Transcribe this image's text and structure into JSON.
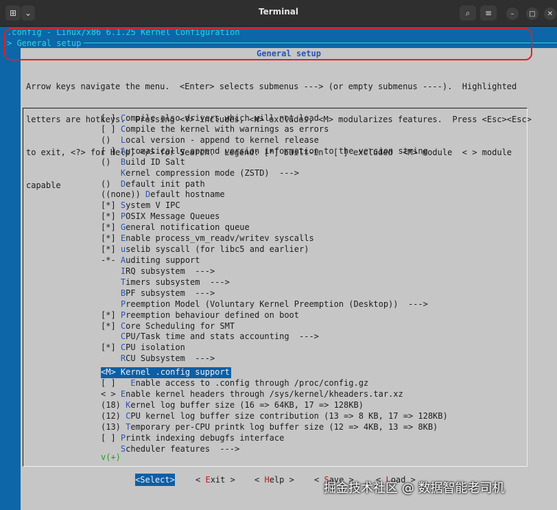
{
  "window": {
    "title": "Terminal",
    "left_buttons": [
      "new-tab",
      "dropdown"
    ],
    "right_buttons": [
      "search",
      "menu",
      "minimize",
      "maximize",
      "close"
    ]
  },
  "header": {
    "config_line": ".config - Linux/x86 6.1.25 Kernel Configuration",
    "breadcrumb": "> General setup"
  },
  "panel": {
    "title": "General setup",
    "help_lines": [
      "Arrow keys navigate the menu.  <Enter> selects submenus ---> (or empty submenus ----).  Highlighted",
      "letters are hotkeys.  Pressing <Y> includes, <N> excludes, <M> modularizes features.  Press <Esc><Esc>",
      "to exit, <?> for Help, </> for Search.  Legend: [*] built-in  [ ] excluded  <M> module  < > module",
      "capable"
    ]
  },
  "menu_items": [
    {
      "prefix": "[ ] ",
      "hotkey": "C",
      "rest": "ompile also drivers which will not load"
    },
    {
      "prefix": "[ ] ",
      "hotkey": "C",
      "rest": "ompile the kernel with warnings as errors"
    },
    {
      "prefix": "()  ",
      "hotkey": "L",
      "rest": "ocal version - append to kernel release"
    },
    {
      "prefix": "[ ] ",
      "hotkey": "A",
      "rest": "utomatically append version information to the version string"
    },
    {
      "prefix": "()  ",
      "hotkey": "B",
      "rest": "uild ID Salt"
    },
    {
      "prefix": "    ",
      "hotkey": "K",
      "rest": "ernel compression mode (ZSTD)  --->"
    },
    {
      "prefix": "()  ",
      "hotkey": "D",
      "rest": "efault init path"
    },
    {
      "prefix": "((none)) ",
      "hotkey": "D",
      "rest": "efault hostname"
    },
    {
      "prefix": "[*] ",
      "hotkey": "S",
      "rest": "ystem V IPC"
    },
    {
      "prefix": "[*] ",
      "hotkey": "P",
      "rest": "OSIX Message Queues"
    },
    {
      "prefix": "[*] ",
      "hotkey": "G",
      "rest": "eneral notification queue"
    },
    {
      "prefix": "[*] ",
      "hotkey": "E",
      "rest": "nable process_vm_readv/writev syscalls"
    },
    {
      "prefix": "[*] ",
      "hotkey": "u",
      "rest": "selib syscall (for libc5 and earlier)"
    },
    {
      "prefix": "-*- ",
      "hotkey": "A",
      "rest": "uditing support"
    },
    {
      "prefix": "    ",
      "hotkey": "I",
      "rest": "RQ subsystem  --->"
    },
    {
      "prefix": "    ",
      "hotkey": "T",
      "rest": "imers subsystem  --->"
    },
    {
      "prefix": "    ",
      "hotkey": "B",
      "rest": "PF subsystem  --->"
    },
    {
      "prefix": "    ",
      "hotkey": "P",
      "rest": "reemption Model (Voluntary Kernel Preemption (Desktop))  --->"
    },
    {
      "prefix": "[*] ",
      "hotkey": "P",
      "rest": "reemption behaviour defined on boot"
    },
    {
      "prefix": "[*] ",
      "hotkey": "C",
      "rest": "ore Scheduling for SMT"
    },
    {
      "prefix": "    ",
      "hotkey": "C",
      "rest": "PU/Task time and stats accounting  --->"
    },
    {
      "prefix": "[*] ",
      "hotkey": "C",
      "rest": "PU isolation"
    },
    {
      "prefix": "    ",
      "hotkey": "R",
      "rest": "CU Subsystem  --->"
    },
    {
      "prefix": "<M> ",
      "hotkey": "K",
      "rest": "ernel .config support",
      "selected": true
    },
    {
      "prefix": "[ ]   ",
      "hotkey": "E",
      "rest": "nable access to .config through /proc/config.gz"
    },
    {
      "prefix": "< > ",
      "hotkey": "E",
      "rest": "nable kernel headers through /sys/kernel/kheaders.tar.xz"
    },
    {
      "prefix": "(18) ",
      "hotkey": "K",
      "rest": "ernel log buffer size (16 => 64KB, 17 => 128KB)"
    },
    {
      "prefix": "(12) ",
      "hotkey": "C",
      "rest": "PU kernel log buffer size contribution (13 => 8 KB, 17 => 128KB)"
    },
    {
      "prefix": "(13) ",
      "hotkey": "T",
      "rest": "emporary per-CPU printk log buffer size (12 => 4KB, 13 => 8KB)"
    },
    {
      "prefix": "[ ] ",
      "hotkey": "P",
      "rest": "rintk indexing debugfs interface"
    },
    {
      "prefix": "    ",
      "hotkey": "S",
      "rest": "cheduler features  --->"
    }
  ],
  "more_indicator": "v(+)",
  "buttons": [
    {
      "pre": "<",
      "hotkey": "S",
      "post": "elect>",
      "selected": true
    },
    {
      "pre": "< ",
      "hotkey": "E",
      "post": "xit >"
    },
    {
      "pre": "< ",
      "hotkey": "H",
      "post": "elp >"
    },
    {
      "pre": "< ",
      "hotkey": "S",
      "post": "ave >"
    },
    {
      "pre": "< ",
      "hotkey": "L",
      "post": "oad >"
    }
  ],
  "watermark": "掘金技术社区 @ 数据智能老司机",
  "colors": {
    "background_blue": "#0c66a8",
    "panel_gray": "#c6c6c6",
    "hotkey_blue": "#2a52b8",
    "header_cyan": "#30d6d6",
    "highlight_box": "#e02020"
  }
}
